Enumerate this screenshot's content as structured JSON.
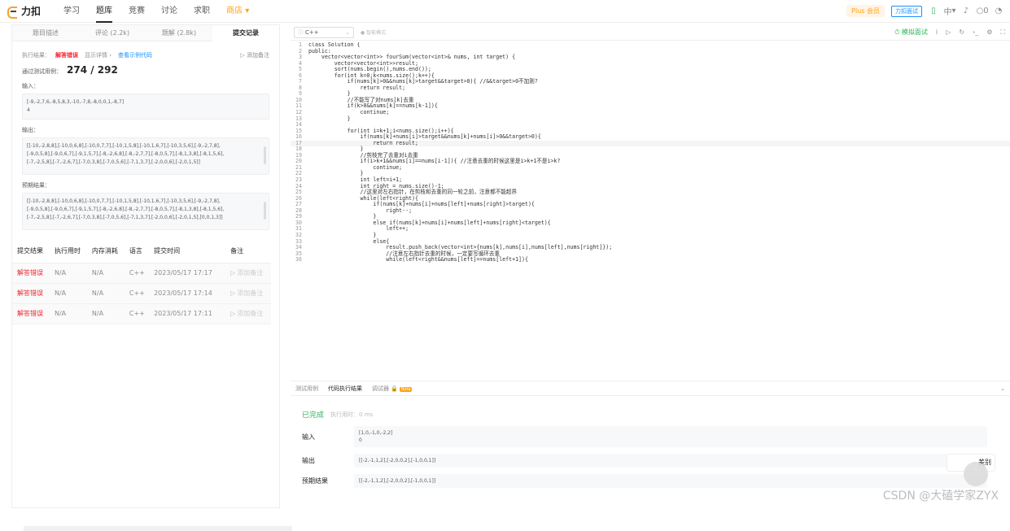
{
  "topbar": {
    "brand": "力扣",
    "nav": [
      "学习",
      "题库",
      "竞赛",
      "讨论",
      "求职",
      "商店"
    ],
    "plus": "Plus 会员",
    "face": "力扣面试",
    "lang": "中",
    "count": "0"
  },
  "left": {
    "tabs": [
      "题目描述",
      "评论 (2.2k)",
      "题解 (2.8k)",
      "提交记录"
    ],
    "exec_label": "执行结果：",
    "exec_status": "解答错误",
    "show_detail": "显示详情 ›",
    "view_example": "查看示例代码",
    "add_note": "添加备注",
    "passed_label": "通过测试用例：",
    "passed_value": "274 / 292",
    "input_label": "输入：",
    "input_value": "[-9,-2,7,6,-8,5,8,3,-10,-7,8,-8,0,0,1,-8,7]",
    "input_target": "4",
    "output_label": "输出：",
    "output_lines": [
      "[[-10,-2,8,8],[-10,0,6,8],[-10,0,7,7],[-10,1,5,8],[-10,1,6,7],[-10,3,5,6],[-9,-2,7,8],",
      "[-9,0,5,8],[-9,0,6,7],[-9,1,5,7],[-8,-2,6,8],[-8,-2,7,7],[-8,0,5,7],[-8,1,3,8],[-8,1,5,6],",
      "[-7,-2,5,8],[-7,-2,6,7],[-7,0,3,8],[-7,0,5,6],[-7,1,3,7],[-2,0,0,6],[-2,0,1,5]]"
    ],
    "expected_label": "预期结果：",
    "expected_lines": [
      "[[-10,-2,8,8],[-10,0,6,8],[-10,0,7,7],[-10,1,5,8],[-10,1,6,7],[-10,3,5,6],[-9,-2,7,8],",
      "[-9,0,5,8],[-9,0,6,7],[-9,1,5,7],[-8,-2,6,8],[-8,-2,7,7],[-8,0,5,7],[-8,1,3,8],[-8,1,5,6],",
      "[-7,-2,5,8],[-7,-2,6,7],[-7,0,3,8],[-7,0,5,6],[-7,1,3,7],[-2,0,0,6],[-2,0,1,5],[0,0,1,3]]"
    ],
    "table": {
      "headers": [
        "提交结果",
        "执行用时",
        "内存消耗",
        "语言",
        "提交时间",
        "备注"
      ],
      "rows": [
        [
          "解答错误",
          "N/A",
          "N/A",
          "C++",
          "2023/05/17 17:17",
          "添加备注"
        ],
        [
          "解答错误",
          "N/A",
          "N/A",
          "C++",
          "2023/05/17 17:14",
          "添加备注"
        ],
        [
          "解答错误",
          "N/A",
          "N/A",
          "C++",
          "2023/05/17 17:11",
          "添加备注"
        ]
      ]
    }
  },
  "editor": {
    "lang": "C++",
    "smart": "智能模式",
    "mock": "模拟面试",
    "lines": [
      "class Solution {",
      "public:",
      "    vector<vector<int>> fourSum(vector<int>& nums, int target) {",
      "        vector<vector<int>>result;",
      "        sort(nums.begin(),nums.end());",
      "        for(int k=0;k<nums.size();k++){",
      "            if(nums[k]>0&&nums[k]>target&&target>0){ //&&target>0不加则?",
      "                return result;",
      "            }",
      "            //不能写了对nums[k]去重",
      "            if(k>0&&nums[k]==nums[k-1]){",
      "                continue;",
      "            }",
      "",
      "            for(int i=k+1;i<nums.size();i++){",
      "                if(nums[k]+nums[i]>target&&nums[k]+nums[i]>0&&target>0){",
      "                    return result;",
      "                }",
      "                //剪枝完了去重对i去重",
      "                if(i>k+1&&nums[i]==nums[i-1]){ //注意去重的时候这里是i>k+1不是i>k?",
      "                    continue;",
      "                }",
      "                int left=i+1;",
      "                int right = nums.size()-1;",
      "                //这里对左右指针，在剪枝和去重的同一轮之前，注意都不能超界",
      "                while(left<right){",
      "                    if(nums[k]+nums[i]+nums[left]+nums[right]>target){",
      "                        right--;",
      "                    }",
      "                    else if(nums[k]+nums[i]+nums[left]+nums[right]<target){",
      "                        left++;",
      "                    }",
      "                    else{",
      "                        result.push_back(vector<int>{nums[k],nums[i],nums[left],nums[right]});",
      "                        //注意左右指针去重的时候，一定要写循环去重",
      "                        while(left<right&&nums[left]==nums[left+1]){"
    ]
  },
  "bottom": {
    "tabs": [
      "测试用例",
      "代码执行结果",
      "调试器"
    ],
    "beta": "Beta",
    "done": "已完成",
    "exec_time": "执行用时：0 ms",
    "input_label": "输入",
    "input_value": "[1,0,-1,0,-2,2]",
    "input_target": "0",
    "output_label": "输出",
    "output_value": "[[-2,-1,1,2],[-2,0,0,2],[-1,0,0,1]]",
    "expected_label": "预期结果",
    "expected_value": "[[-2,-1,1,2],[-2,0,0,2],[-1,0,0,1]]",
    "diff": "差别"
  },
  "watermark": "CSDN @大磕学家ZYX"
}
